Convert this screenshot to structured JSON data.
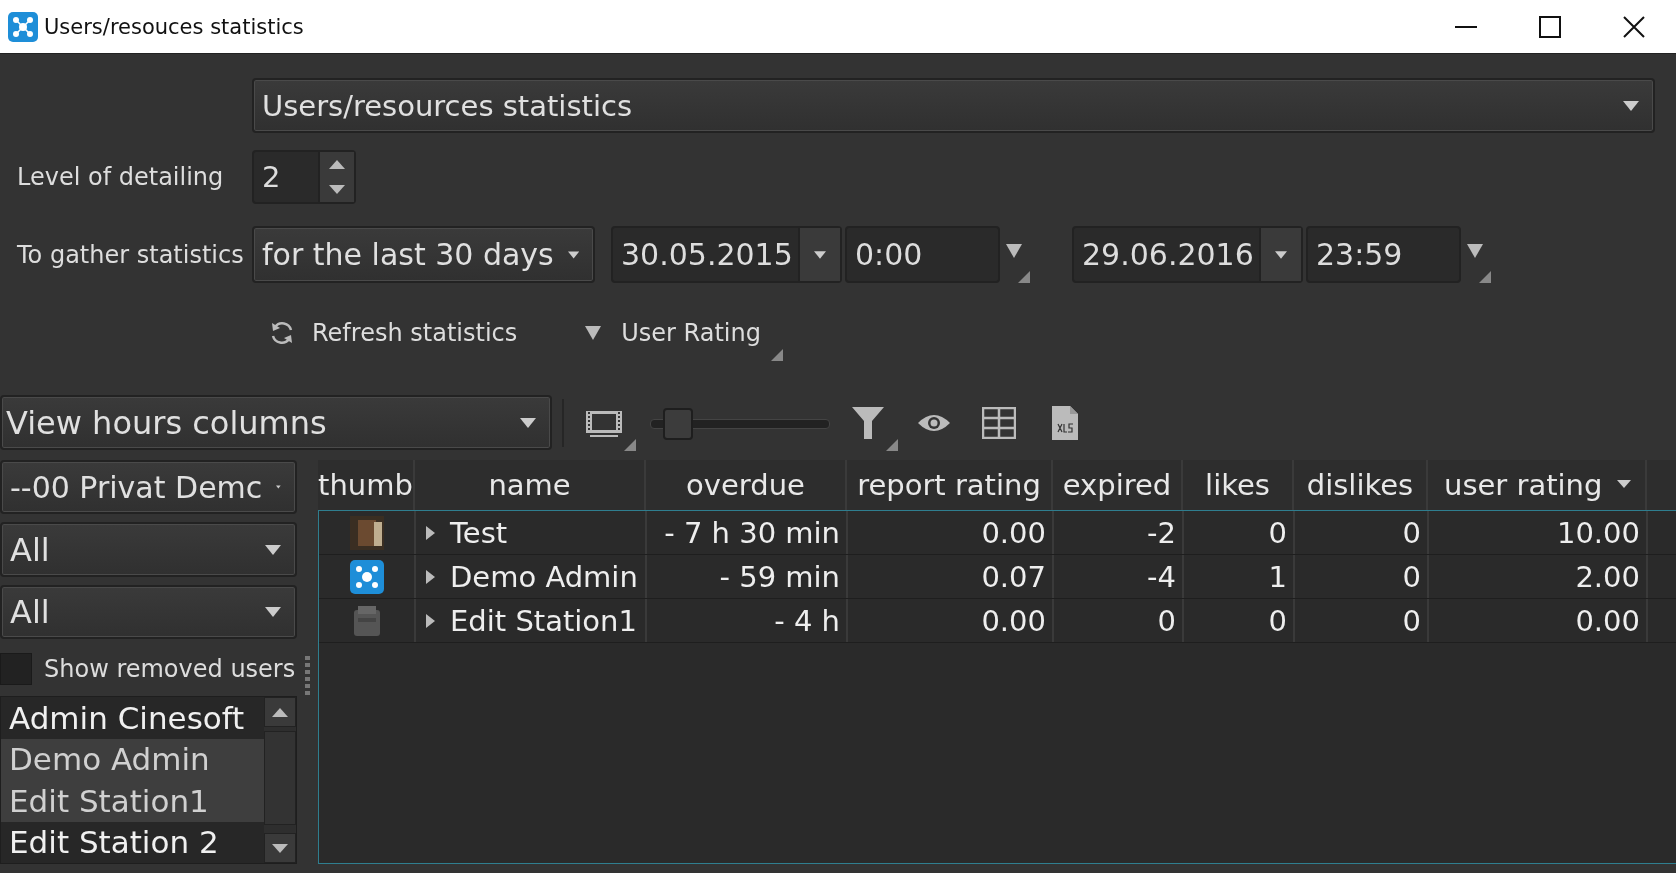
{
  "window": {
    "title": "Users/resouces statistics"
  },
  "report": {
    "value": "Users/resources statistics"
  },
  "detailing": {
    "label": "Level of detailing",
    "value": "2"
  },
  "gather": {
    "label": "To gather statistics",
    "period": "for the last 30 days",
    "from_date": "30.05.2015",
    "from_time": "0:00",
    "to_date": "29.06.2016",
    "to_time": "23:59"
  },
  "actions": {
    "refresh": "Refresh statistics",
    "rating": "User Rating"
  },
  "view_columns": "View hours columns",
  "toolbar": {
    "slider": {
      "level": 0.15
    }
  },
  "filters": {
    "group": "--00 Privat Demc",
    "filter_2": "All",
    "filter_3": "All",
    "show_removed": {
      "label": "Show removed users",
      "checked": false
    }
  },
  "users": [
    {
      "name": "Admin Cinesoft",
      "selected": false
    },
    {
      "name": "Demo Admin",
      "selected": true
    },
    {
      "name": "Edit Station1",
      "selected": true
    },
    {
      "name": "Edit Station 2",
      "selected": false
    }
  ],
  "table": {
    "columns": [
      {
        "label": "thumb",
        "sorted": false
      },
      {
        "label": "name",
        "sorted": false
      },
      {
        "label": "overdue",
        "sorted": false
      },
      {
        "label": "report rating",
        "sorted": false
      },
      {
        "label": "expired",
        "sorted": false
      },
      {
        "label": "likes",
        "sorted": false
      },
      {
        "label": "dislikes",
        "sorted": false
      },
      {
        "label": "user rating",
        "sorted": true
      }
    ],
    "rows": [
      {
        "kind": "photo",
        "expanded": false,
        "cells": [
          "",
          "Test",
          "- 7 h 30 min",
          "0.00",
          "-2",
          "0",
          "0",
          "10.00"
        ]
      },
      {
        "kind": "logo",
        "expanded": false,
        "cells": [
          "",
          "Demo Admin",
          "- 59 min",
          "0.07",
          "-4",
          "1",
          "0",
          "2.00"
        ]
      },
      {
        "kind": "device",
        "expanded": false,
        "cells": [
          "",
          "Edit Station1",
          "- 4 h",
          "0.00",
          "0",
          "0",
          "0",
          "0.00"
        ]
      }
    ]
  }
}
